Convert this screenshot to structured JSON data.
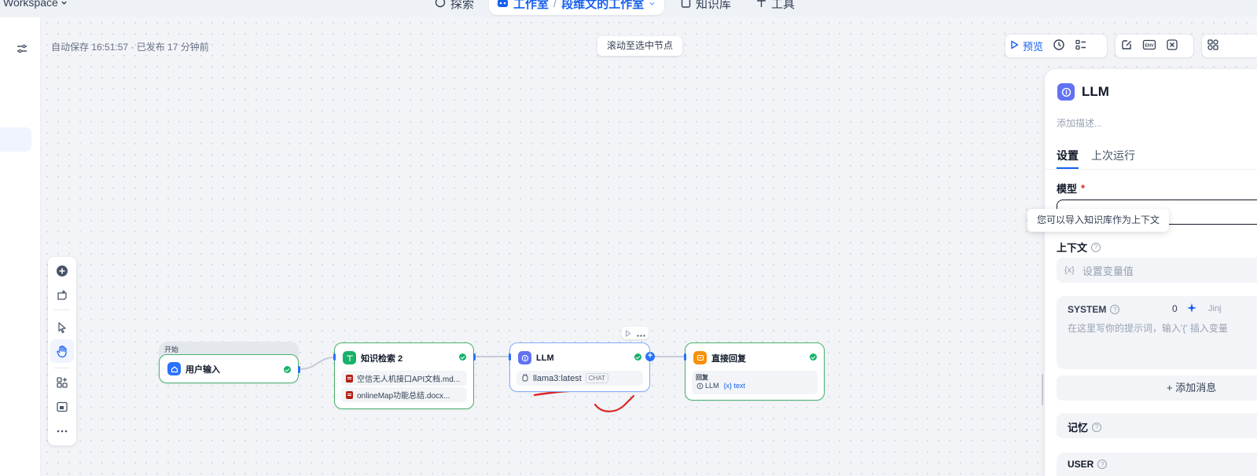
{
  "topnav": {
    "workspace": "Workspace",
    "explore": "探索",
    "studio": "工作室",
    "studio_sub": "段维文的工作室",
    "knowledge": "知识库",
    "tools": "工具"
  },
  "canvas": {
    "autosave": "自动保存 16:51:57 · 已发布 17 分钟前",
    "scroll_to_selected": "滚动至选中节点",
    "preview": "预览",
    "env_label": "ENV",
    "tooltip": "您可以导入知识库作为上下文"
  },
  "nodes": {
    "start": {
      "group_label": "开始",
      "title": "用户输入"
    },
    "knowledge": {
      "title": "知识检索 2",
      "items": [
        "空信无人机接口API文档.md...",
        "onlineMap功能总结.docx..."
      ]
    },
    "llm": {
      "title": "LLM",
      "model": "llama3:latest",
      "mode": "CHAT"
    },
    "answer": {
      "title": "直接回复",
      "section": "回复",
      "var_source": "LLM",
      "var_name": "{x} text"
    }
  },
  "panel": {
    "title": "LLM",
    "description_placeholder": "添加描述...",
    "tabs": [
      "设置",
      "上次运行"
    ],
    "model_label": "模型",
    "required_mark": "*",
    "context_label": "上下文",
    "context_var_icon": "{x}",
    "context_placeholder": "设置变量值",
    "system_label": "SYSTEM",
    "system_count": "0",
    "system_jinja": "Jinj",
    "system_placeholder": "在这里写你的提示词，输入'{' 插入变量",
    "add_message": "+ 添加消息",
    "memory_label": "记忆",
    "user_label": "USER"
  },
  "colors": {
    "accent": "#155eef",
    "success": "#17b26a",
    "knowledge_icon": "#17b26a",
    "llm_icon": "#6172f3",
    "answer_icon": "#f79009",
    "start_icon": "#2970ff",
    "annotation_red": "#e02424"
  }
}
